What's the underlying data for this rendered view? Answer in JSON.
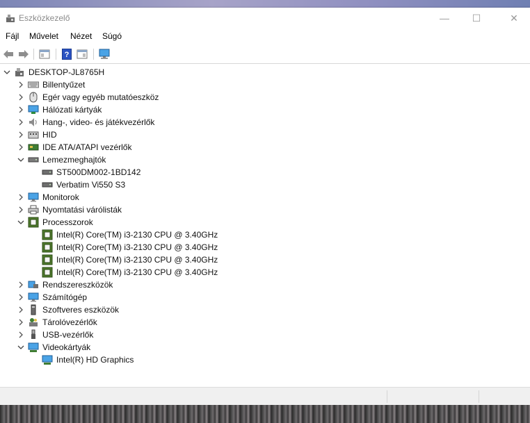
{
  "window": {
    "title": "Eszközkezelő",
    "minimize": "—",
    "maximize": "☐",
    "close": "✕"
  },
  "menu": {
    "items": [
      "Fájl",
      "Művelet",
      "Nézet",
      "Súgó"
    ]
  },
  "toolbar": {
    "buttons": [
      "back-arrow-icon",
      "forward-arrow-icon",
      "properties-icon",
      "help-icon",
      "view-icon",
      "monitor-scan-icon"
    ]
  },
  "tree": {
    "root": "DESKTOP-JL8765H",
    "categories": [
      {
        "label": "Billentyűzet",
        "icon": "keyboard-icon",
        "expanded": false
      },
      {
        "label": "Egér vagy egyéb mutatóeszköz",
        "icon": "mouse-icon",
        "expanded": false
      },
      {
        "label": "Hálózati kártyák",
        "icon": "network-adapter-icon",
        "expanded": false
      },
      {
        "label": "Hang-, video- és játékvezérlők",
        "icon": "speaker-icon",
        "expanded": false
      },
      {
        "label": "HID",
        "icon": "hid-icon",
        "expanded": false
      },
      {
        "label": "IDE ATA/ATAPI vezérlők",
        "icon": "ide-controller-icon",
        "expanded": false
      },
      {
        "label": "Lemezmeghajtók",
        "icon": "disk-drive-icon",
        "expanded": true,
        "children": [
          "ST500DM002-1BD142",
          "Verbatim Vi550 S3"
        ]
      },
      {
        "label": "Monitorok",
        "icon": "monitor-icon",
        "expanded": false
      },
      {
        "label": "Nyomtatási várólisták",
        "icon": "printer-icon",
        "expanded": false
      },
      {
        "label": "Processzorok",
        "icon": "processor-icon",
        "expanded": true,
        "children": [
          "Intel(R) Core(TM) i3-2130 CPU @ 3.40GHz",
          "Intel(R) Core(TM) i3-2130 CPU @ 3.40GHz",
          "Intel(R) Core(TM) i3-2130 CPU @ 3.40GHz",
          "Intel(R) Core(TM) i3-2130 CPU @ 3.40GHz"
        ]
      },
      {
        "label": "Rendszereszközök",
        "icon": "system-devices-icon",
        "expanded": false
      },
      {
        "label": "Számítógép",
        "icon": "computer-icon",
        "expanded": false
      },
      {
        "label": "Szoftveres eszközök",
        "icon": "software-device-icon",
        "expanded": false
      },
      {
        "label": "Tárolóvezérlők",
        "icon": "storage-controller-icon",
        "expanded": false
      },
      {
        "label": "USB-vezérlők",
        "icon": "usb-icon",
        "expanded": false
      },
      {
        "label": "Videokártyák",
        "icon": "display-adapter-icon",
        "expanded": true,
        "children": [
          "Intel(R) HD Graphics"
        ]
      }
    ]
  },
  "colors": {
    "accent": "#3c8ed8",
    "chip_green": "#4f7b2c"
  }
}
